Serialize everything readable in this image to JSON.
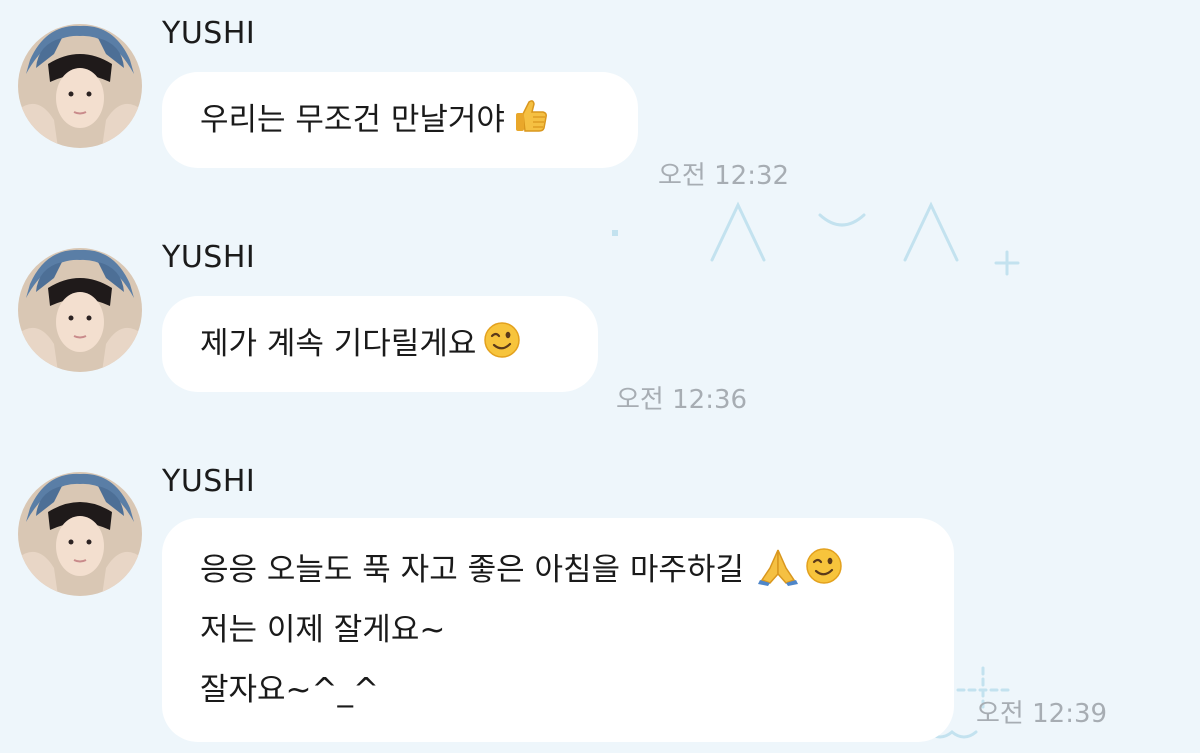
{
  "messages": [
    {
      "sender": "YUSHI",
      "lines": [
        "우리는 무조건 만날거야"
      ],
      "emojis": [
        "thumbs-up"
      ],
      "time": "오전 12:32"
    },
    {
      "sender": "YUSHI",
      "lines": [
        "제가 계속 기다릴게요"
      ],
      "emojis": [
        "winking-face"
      ],
      "time": "오전 12:36"
    },
    {
      "sender": "YUSHI",
      "lines": [
        "응응 오늘도 푹 자고 좋은 아침을 마주하길",
        "저는 이제 잘게요~",
        "잘자요~^_^"
      ],
      "emojis": [
        "folded-hands",
        "winking-face"
      ],
      "time": "오전 12:39"
    }
  ],
  "colors": {
    "background": "#eef6fb",
    "bubble": "#ffffff",
    "timestamp": "#a7adb3",
    "decoration": "#b9ddec"
  }
}
